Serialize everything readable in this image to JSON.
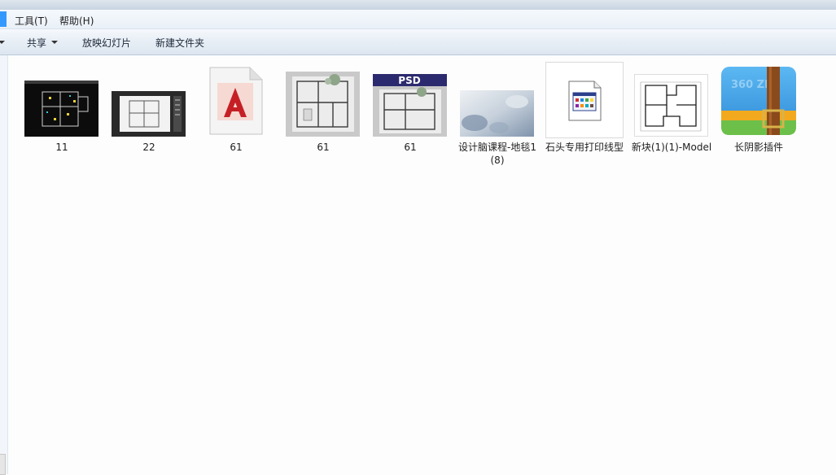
{
  "menu": {
    "tools": "工具(T)",
    "help": "帮助(H)"
  },
  "toolbar": {
    "share": "共享",
    "slideshow": "放映幻灯片",
    "new_folder": "新建文件夹"
  },
  "files": [
    {
      "name": "11",
      "icon": "dwg-thumbnail-icon"
    },
    {
      "name": "22",
      "icon": "dwg-thumbnail-icon"
    },
    {
      "name": "61",
      "icon": "autocad-file-icon"
    },
    {
      "name": "61",
      "icon": "floorplan-image-icon"
    },
    {
      "name": "61",
      "icon": "psd-file-icon",
      "badge": "PSD"
    },
    {
      "name": "设计脑课程-地毯1 (8)",
      "icon": "carpet-image-icon"
    },
    {
      "name": "石头专用打印线型",
      "icon": "plot-style-file-icon"
    },
    {
      "name": "新块(1)(1)-Model",
      "icon": "floorplan-image-icon"
    },
    {
      "name": "长阴影插件",
      "icon": "zip-archive-icon",
      "badge": "360 ZIP"
    }
  ]
}
